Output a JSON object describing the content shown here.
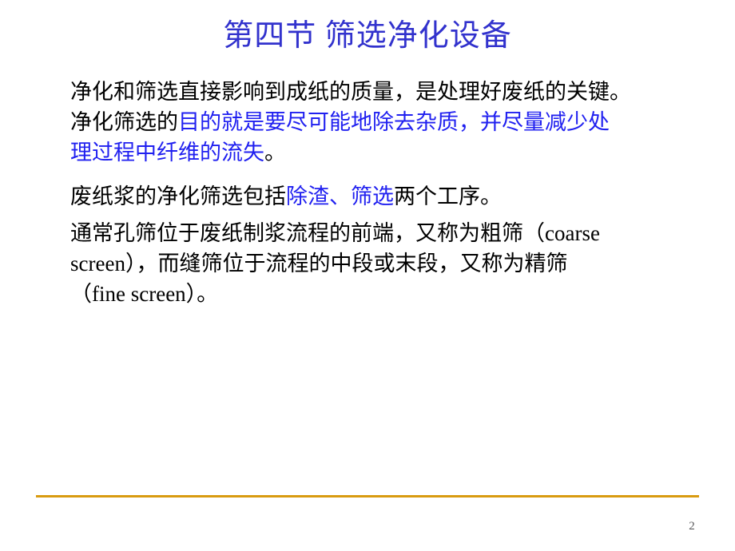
{
  "slide": {
    "title": "第四节 筛选净化设备",
    "page_number": "2",
    "colors": {
      "title_blue": "#3232cd",
      "body_blue": "#2020f0",
      "body_black": "#000000",
      "rule_gold": "#d99b10",
      "page_number_gray": "#59595b",
      "background": "#ffffff"
    },
    "paragraphs": [
      {
        "id": "p1",
        "lines": [
          {
            "runs": [
              {
                "text": "净化和筛选直接影响到成纸的质量，是处理好废纸的关键。",
                "color": "black"
              }
            ]
          },
          {
            "runs": [
              {
                "text": "净化筛选的",
                "color": "black"
              },
              {
                "text": "目的就是要尽可能地除去杂质，并尽量减少处",
                "color": "blue"
              }
            ]
          },
          {
            "runs": [
              {
                "text": "理过程中纤维的流失",
                "color": "blue"
              },
              {
                "text": "。",
                "color": "black"
              }
            ]
          }
        ]
      },
      {
        "id": "p2",
        "lines": [
          {
            "runs": [
              {
                "text": "废纸浆的净化筛选包括",
                "color": "black"
              },
              {
                "text": "除渣、筛选",
                "color": "blue"
              },
              {
                "text": "两个工序。",
                "color": "black"
              }
            ]
          }
        ]
      },
      {
        "id": "p3",
        "lines": [
          {
            "runs": [
              {
                "text": "通常孔筛位于废纸制浆流程的前端，又称为粗筛（coarse",
                "color": "black"
              }
            ]
          },
          {
            "runs": [
              {
                "text": "screen），而缝筛位于流程的中段或末段，又称为精筛",
                "color": "black"
              }
            ]
          },
          {
            "runs": [
              {
                "text": "（fine screen）。",
                "color": "black"
              }
            ]
          }
        ]
      }
    ]
  }
}
